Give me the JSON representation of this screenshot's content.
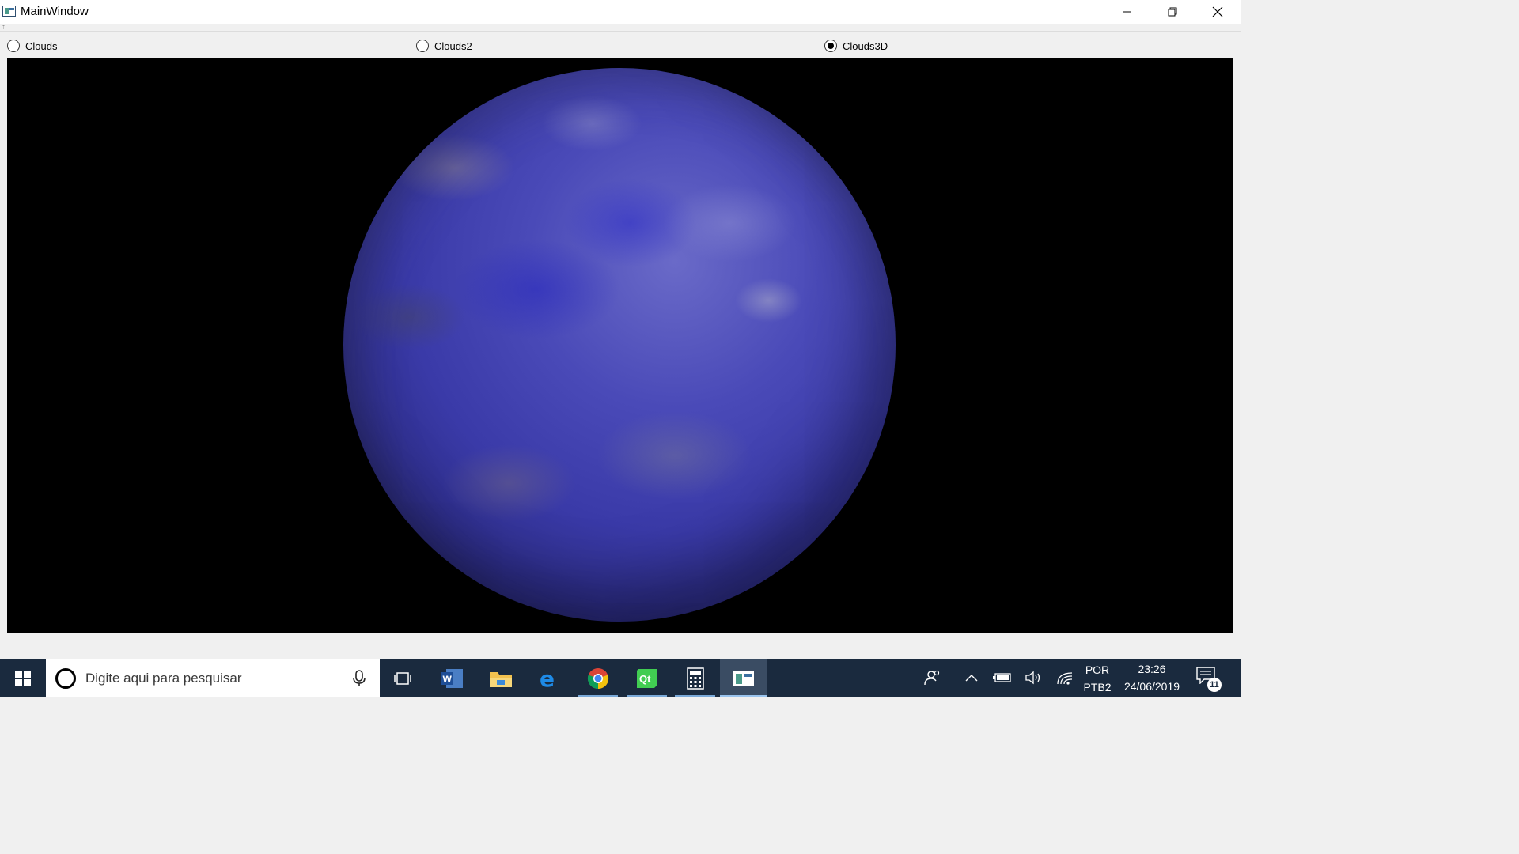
{
  "window": {
    "title": "MainWindow"
  },
  "radios": [
    {
      "label": "Clouds",
      "checked": false
    },
    {
      "label": "Clouds2",
      "checked": false
    },
    {
      "label": "Clouds3D",
      "checked": true
    }
  ],
  "viewport": {
    "content": "3D sphere with blue cloud texture",
    "background": "#000000",
    "sphere_color": "#4a4ab8"
  },
  "taskbar": {
    "search_placeholder": "Digite aqui para pesquisar",
    "apps": [
      {
        "name": "task-view",
        "running": false
      },
      {
        "name": "word",
        "running": false
      },
      {
        "name": "file-explorer",
        "running": false
      },
      {
        "name": "edge",
        "running": false
      },
      {
        "name": "chrome",
        "running": true
      },
      {
        "name": "qt-creator",
        "running": true
      },
      {
        "name": "calculator",
        "running": true
      },
      {
        "name": "mainwindow-app",
        "running": true,
        "active": true
      }
    ],
    "language_1": "POR",
    "language_2": "PTB2",
    "time": "23:26",
    "date": "24/06/2019",
    "notification_count": "11",
    "background": "#1a2a3e"
  }
}
